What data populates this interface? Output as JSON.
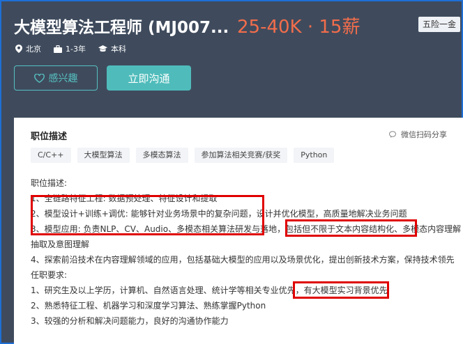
{
  "job": {
    "title": "大模型算法工程师 (MJ007...",
    "salary": "25-40K · 15薪",
    "benefit": "五险一金",
    "city": "北京",
    "experience": "1-3年",
    "education": "本科"
  },
  "actions": {
    "interest_label": "感兴趣",
    "chat_label": "立即沟通"
  },
  "detail": {
    "section_title": "职位描述",
    "share_label": "微信扫码分享",
    "tags": [
      "C/C++",
      "大模型算法",
      "多模态算法",
      "参加算法相关竞赛/获奖",
      "Python"
    ],
    "lines": [
      "职位描述:",
      "1、全链路特征工程: 数据预处理、特征设计和提取",
      "2、模型设计+训练+调优: 能够针对业务场景中的复杂问题，设计并优化模型，高质量地解决业务问题",
      "3、模型应用: 负责NLP、CV、Audio、多模态相关算法研发与落地，包括但不限于文本内容结构化、多模态内容理解",
      "抽取及意图理解",
      "4、探索前沿技术在内容理解领域的应用，包括基础大模型的应用以及场景优化，提出创新技术方案，保持技术领先",
      "任职要求:",
      "1、研究生及以上学历，计算机、自然语言处理、统计学等相关专业优先，有大模型实习背景优先",
      "2、熟悉特征工程、机器学习和深度学习算法、熟练掌握Python",
      "3、较强的分析和解决问题能力，良好的沟通协作能力"
    ]
  },
  "colors": {
    "header_bg": "#3f4b5d",
    "salary": "#f26d4b",
    "accent": "#4fbcbb",
    "highlight": "#e00000"
  }
}
